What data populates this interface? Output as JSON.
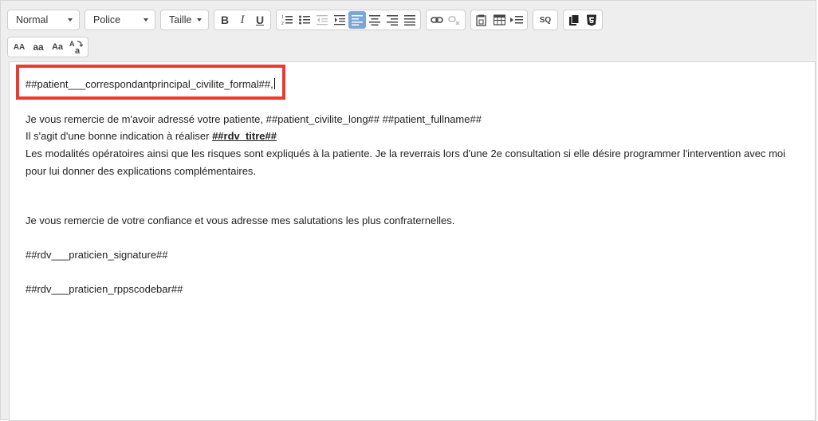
{
  "toolbar": {
    "format_dropdown": "Normal",
    "font_dropdown": "Police",
    "size_dropdown": "Taille",
    "bold": "B",
    "italic": "I",
    "underline": "U",
    "source_button": "SQ",
    "case_upper": "AA",
    "case_lower": "aa",
    "case_title": "Aa"
  },
  "document": {
    "salutation": "##patient___correspondantprincipal_civilite_formal##,",
    "line1": "Je vous remercie de m'avoir adressé votre patiente, ##patient_civilite_long## ##patient_fullname##",
    "line2_prefix": "Il s'agit d'une bonne indication à réaliser ",
    "line2_bold": "##rdv_titre##",
    "paragraph": "Les modalités opératoires ainsi que les risques sont expliqués à la patiente. Je la reverrais lors d'une 2e consultation si elle désire programmer l'intervention avec moi pour lui donner des explications complémentaires.",
    "thanks": "Je vous remercie de votre confiance et vous adresse mes salutations les plus confraternelles.",
    "signature": "##rdv___praticien_signature##",
    "rpps": "##rdv___praticien_rppscodebar##"
  },
  "colors": {
    "highlight_border": "#ee3a2c",
    "active_button": "#7aa7d7"
  }
}
